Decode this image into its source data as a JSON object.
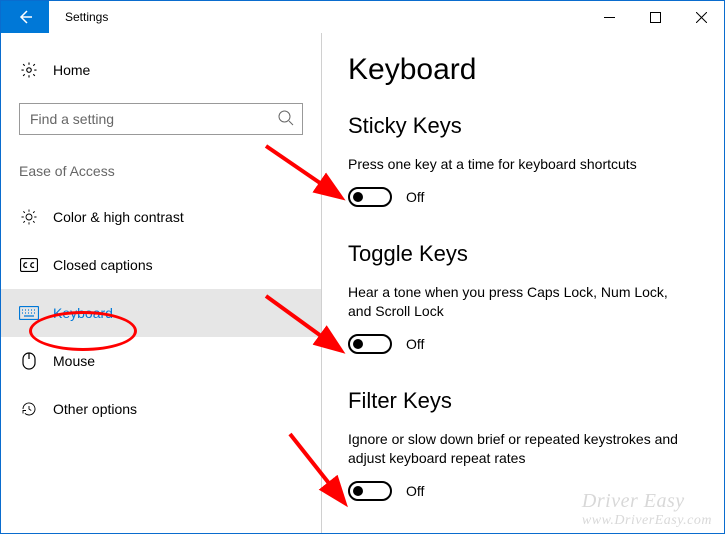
{
  "window": {
    "title": "Settings"
  },
  "sidebar": {
    "home_label": "Home",
    "search_placeholder": "Find a setting",
    "category_header": "Ease of Access",
    "items": [
      {
        "label": "Color & high contrast"
      },
      {
        "label": "Closed captions"
      },
      {
        "label": "Keyboard"
      },
      {
        "label": "Mouse"
      },
      {
        "label": "Other options"
      }
    ]
  },
  "page": {
    "title": "Keyboard",
    "sections": [
      {
        "heading": "Sticky Keys",
        "description": "Press one key at a time for keyboard shortcuts",
        "toggle_state": "Off"
      },
      {
        "heading": "Toggle Keys",
        "description": "Hear a tone when you press Caps Lock, Num Lock, and Scroll Lock",
        "toggle_state": "Off"
      },
      {
        "heading": "Filter Keys",
        "description": "Ignore or slow down brief or repeated keystrokes and adjust keyboard repeat rates",
        "toggle_state": "Off"
      }
    ]
  },
  "watermark": {
    "line1": "Driver Easy",
    "line2": "www.DriverEasy.com"
  }
}
